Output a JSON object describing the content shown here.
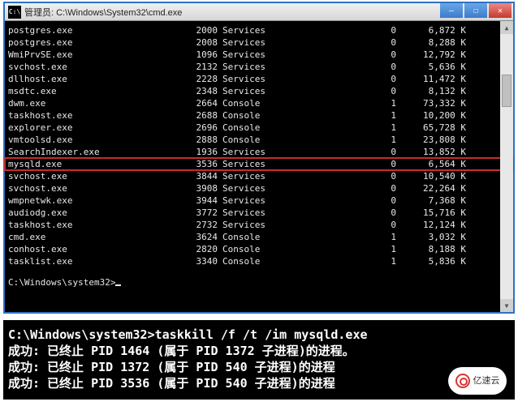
{
  "window": {
    "icon_label": "C:\\",
    "title": "管理员: C:\\Windows\\System32\\cmd.exe"
  },
  "processes": [
    {
      "name": "postgres.exe",
      "pid": "2000",
      "session": "Services",
      "sid": "0",
      "mem": "6,872 K",
      "hl": false
    },
    {
      "name": "postgres.exe",
      "pid": "2008",
      "session": "Services",
      "sid": "0",
      "mem": "8,288 K",
      "hl": false
    },
    {
      "name": "WmiPrvSE.exe",
      "pid": "1096",
      "session": "Services",
      "sid": "0",
      "mem": "12,792 K",
      "hl": false
    },
    {
      "name": "svchost.exe",
      "pid": "2132",
      "session": "Services",
      "sid": "0",
      "mem": "5,636 K",
      "hl": false
    },
    {
      "name": "dllhost.exe",
      "pid": "2228",
      "session": "Services",
      "sid": "0",
      "mem": "11,472 K",
      "hl": false
    },
    {
      "name": "msdtc.exe",
      "pid": "2348",
      "session": "Services",
      "sid": "0",
      "mem": "8,132 K",
      "hl": false
    },
    {
      "name": "dwm.exe",
      "pid": "2664",
      "session": "Console",
      "sid": "1",
      "mem": "73,332 K",
      "hl": false
    },
    {
      "name": "taskhost.exe",
      "pid": "2688",
      "session": "Console",
      "sid": "1",
      "mem": "10,200 K",
      "hl": false
    },
    {
      "name": "explorer.exe",
      "pid": "2696",
      "session": "Console",
      "sid": "1",
      "mem": "65,728 K",
      "hl": false
    },
    {
      "name": "vmtoolsd.exe",
      "pid": "2888",
      "session": "Console",
      "sid": "1",
      "mem": "23,808 K",
      "hl": false
    },
    {
      "name": "SearchIndexer.exe",
      "pid": "1936",
      "session": "Services",
      "sid": "0",
      "mem": "13,852 K",
      "hl": false
    },
    {
      "name": "mysqld.exe",
      "pid": "3536",
      "session": "Services",
      "sid": "0",
      "mem": "6,564 K",
      "hl": true
    },
    {
      "name": "svchost.exe",
      "pid": "3844",
      "session": "Services",
      "sid": "0",
      "mem": "10,540 K",
      "hl": false
    },
    {
      "name": "svchost.exe",
      "pid": "3908",
      "session": "Services",
      "sid": "0",
      "mem": "22,264 K",
      "hl": false
    },
    {
      "name": "wmpnetwk.exe",
      "pid": "3944",
      "session": "Services",
      "sid": "0",
      "mem": "7,368 K",
      "hl": false
    },
    {
      "name": "audiodg.exe",
      "pid": "3772",
      "session": "Services",
      "sid": "0",
      "mem": "15,716 K",
      "hl": false
    },
    {
      "name": "taskhost.exe",
      "pid": "2732",
      "session": "Services",
      "sid": "0",
      "mem": "12,124 K",
      "hl": false
    },
    {
      "name": "cmd.exe",
      "pid": "3624",
      "session": "Console",
      "sid": "1",
      "mem": "3,032 K",
      "hl": false
    },
    {
      "name": "conhost.exe",
      "pid": "2820",
      "session": "Console",
      "sid": "1",
      "mem": "8,188 K",
      "hl": false
    },
    {
      "name": "tasklist.exe",
      "pid": "3340",
      "session": "Console",
      "sid": "1",
      "mem": "5,836 K",
      "hl": false
    }
  ],
  "prompt": "C:\\Windows\\system32>",
  "snippet": {
    "cmd": "C:\\Windows\\system32>taskkill /f /t /im mysqld.exe",
    "l1": "成功: 已终止 PID 1464 (属于 PID 1372 子进程)的进程。",
    "l2": "成功: 已终止 PID 1372 (属于 PID 540 子进程)的进程",
    "l3": "成功: 已终止 PID 3536 (属于 PID 540 子进程)的进程"
  },
  "watermark": "亿速云"
}
